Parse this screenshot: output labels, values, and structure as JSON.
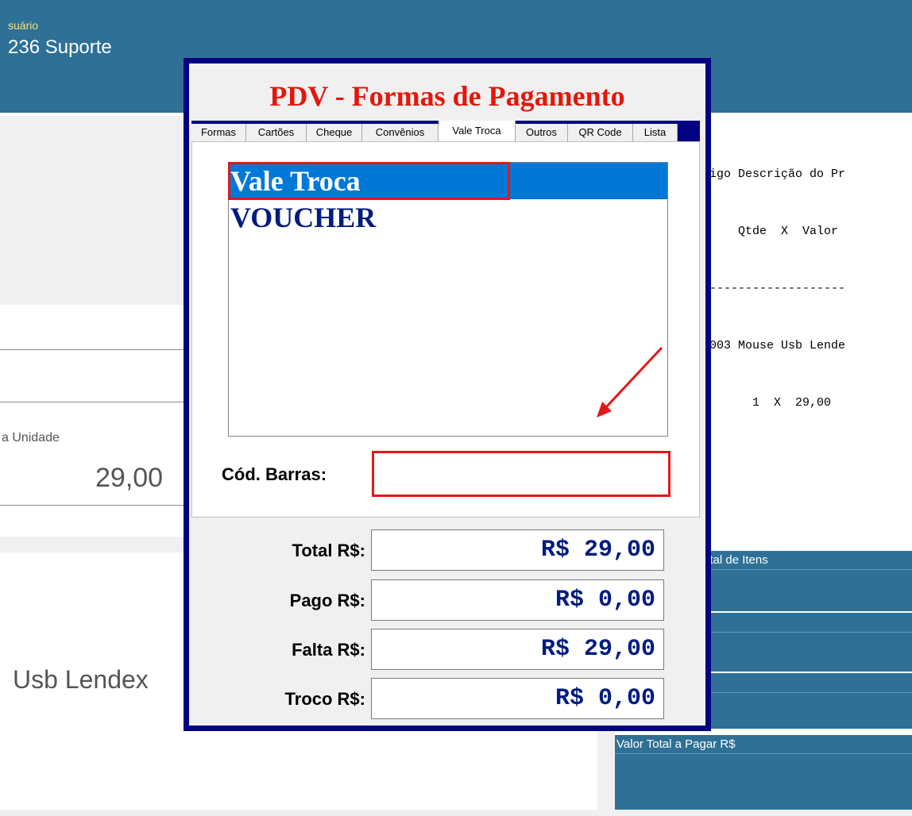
{
  "background": {
    "user_label": "suário",
    "user_name": "236 Suporte",
    "unidade_label": "a Unidade",
    "unit_price": "29,00",
    "product_name": "Usb Lendex",
    "receipt_lines": [
      "igo Descrição do Pr",
      "    Qtde  X  Valor",
      "-------------------",
      "003 Mouse Usb Lende",
      "      1  X  29,00"
    ],
    "panel_total_itens": "otal de Itens",
    "panel_valor_total": "Valor Total a Pagar R$"
  },
  "dialog": {
    "title": "PDV - Formas de Pagamento",
    "tabs": [
      {
        "label": "Formas"
      },
      {
        "label": "Cartões"
      },
      {
        "label": "Cheque"
      },
      {
        "label": "Convênios"
      },
      {
        "label": "Vale Troca",
        "active": true
      },
      {
        "label": "Outros"
      },
      {
        "label": "QR Code"
      },
      {
        "label": "Lista"
      }
    ],
    "list_items": [
      "Vale Troca",
      "VOUCHER"
    ],
    "selected_item": "Vale Troca",
    "barcode_label": "Cód. Barras:",
    "barcode_value": "",
    "totals": [
      {
        "label": "Total R$:",
        "value": "R$ 29,00"
      },
      {
        "label": "Pago R$:",
        "value": "R$ 0,00"
      },
      {
        "label": "Falta R$:",
        "value": "R$ 29,00"
      },
      {
        "label": "Troco R$:",
        "value": "R$ 0,00"
      }
    ]
  },
  "colors": {
    "app_blue": "#2e7096",
    "dialog_border": "#000080",
    "title_red": "#e3170a",
    "value_navy": "#001c80",
    "selection_blue": "#0078d7",
    "annotation_red": "#e31818"
  }
}
